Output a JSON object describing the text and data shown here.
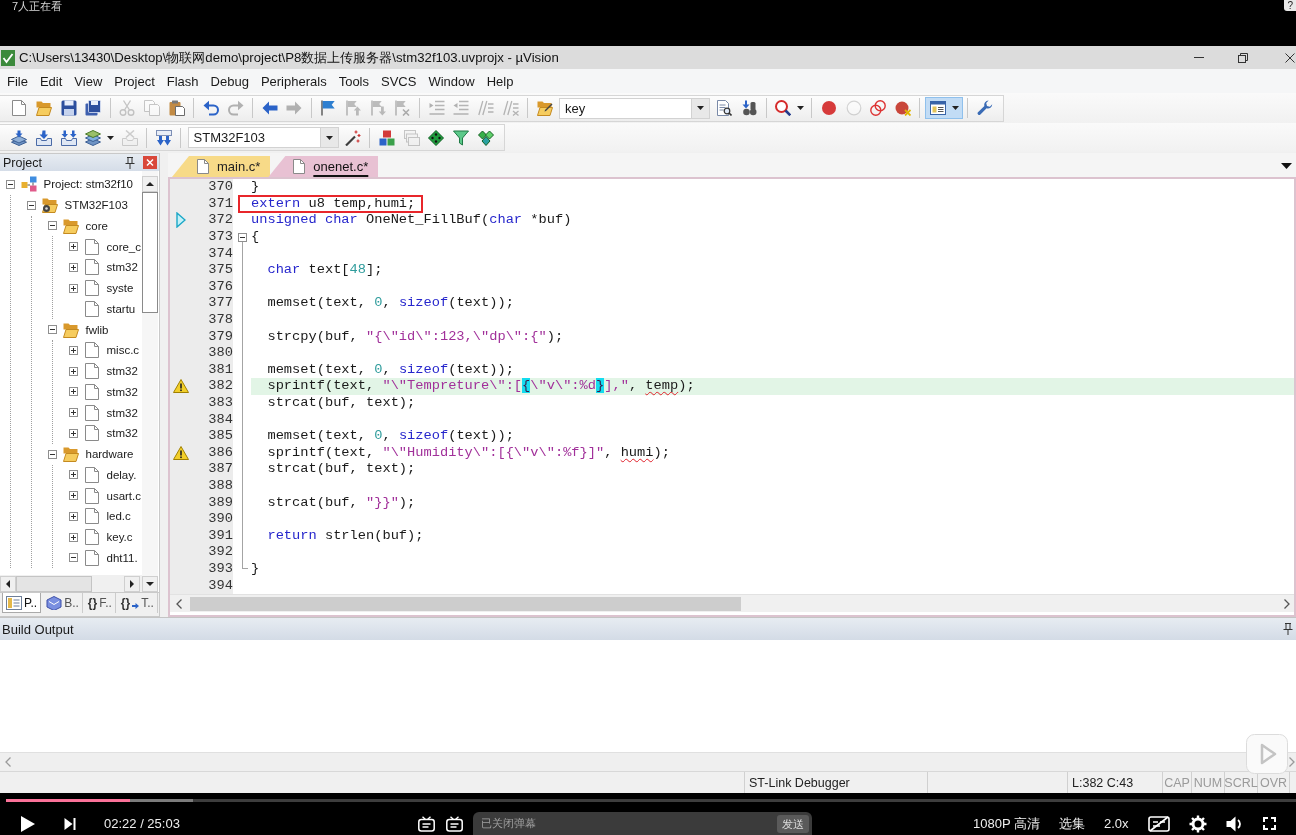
{
  "overlay": {
    "viewers": "7人正在看",
    "help": "?"
  },
  "window": {
    "title": "C:\\Users\\13430\\Desktop\\物联网demo\\project\\P8数据上传服务器\\stm32f103.uvprojx - µVision"
  },
  "menu": [
    "File",
    "Edit",
    "View",
    "Project",
    "Flash",
    "Debug",
    "Peripherals",
    "Tools",
    "SVCS",
    "Window",
    "Help"
  ],
  "toolbars": [
    [
      {
        "kind": "new",
        "disabled": false
      },
      {
        "kind": "open",
        "disabled": false
      },
      {
        "kind": "save",
        "disabled": false
      },
      {
        "kind": "save_all",
        "disabled": false
      },
      {
        "kind": "separator"
      },
      {
        "kind": "cut",
        "disabled": true
      },
      {
        "kind": "copy",
        "disabled": true
      },
      {
        "kind": "paste",
        "disabled": false
      },
      {
        "kind": "separator"
      },
      {
        "kind": "undo",
        "disabled": false
      },
      {
        "kind": "redo",
        "disabled": true
      },
      {
        "kind": "separator"
      },
      {
        "kind": "back",
        "disabled": false
      },
      {
        "kind": "forward",
        "disabled": true
      },
      {
        "kind": "separator"
      },
      {
        "kind": "bookmark",
        "disabled": false
      },
      {
        "kind": "bookmark_prev",
        "disabled": true
      },
      {
        "kind": "bookmark_next",
        "disabled": true
      },
      {
        "kind": "bookmark_clear",
        "disabled": true
      },
      {
        "kind": "separator"
      },
      {
        "kind": "indent",
        "disabled": true
      },
      {
        "kind": "unindent",
        "disabled": true
      },
      {
        "kind": "comment",
        "disabled": true
      },
      {
        "kind": "uncomment",
        "disabled": true
      },
      {
        "kind": "separator"
      },
      {
        "kind": "find_in_files",
        "disabled": false
      },
      {
        "kind": "combo",
        "value": "key"
      },
      {
        "kind": "find",
        "disabled": false
      },
      {
        "kind": "incremental_find",
        "disabled": false
      },
      {
        "kind": "separator"
      },
      {
        "kind": "debug",
        "disabled": false,
        "menu": true
      },
      {
        "kind": "separator"
      },
      {
        "kind": "breakpoint",
        "disabled": false
      },
      {
        "kind": "breakpoint_enable",
        "disabled": true
      },
      {
        "kind": "breakpoints_disable",
        "disabled": false
      },
      {
        "kind": "breakpoints_kill",
        "disabled": false
      },
      {
        "kind": "separator"
      },
      {
        "kind": "window",
        "disabled": false,
        "menu": true,
        "highlighted": true
      },
      {
        "kind": "separator"
      },
      {
        "kind": "configure",
        "disabled": false
      }
    ],
    [
      {
        "kind": "translate",
        "disabled": false
      },
      {
        "kind": "build",
        "disabled": false
      },
      {
        "kind": "rebuild",
        "disabled": false
      },
      {
        "kind": "batch_build",
        "disabled": false,
        "menu": true
      },
      {
        "kind": "stop_build",
        "disabled": true
      },
      {
        "kind": "separator"
      },
      {
        "kind": "download",
        "disabled": false
      },
      {
        "kind": "separator"
      },
      {
        "kind": "combo",
        "value": "STM32F103"
      },
      {
        "kind": "target_options",
        "disabled": false
      },
      {
        "kind": "separator"
      },
      {
        "kind": "components",
        "disabled": false
      },
      {
        "kind": "manage",
        "disabled": true
      },
      {
        "kind": "packs",
        "disabled": false
      },
      {
        "kind": "select_packs",
        "disabled": false
      },
      {
        "kind": "pack_installer",
        "disabled": false
      }
    ]
  ],
  "project_panel": {
    "title": "Project",
    "tree": [
      {
        "label": "Project: stm32f10",
        "kind": "project",
        "expanded": true,
        "children": [
          {
            "label": "STM32F103",
            "kind": "target",
            "expanded": true,
            "children": [
              {
                "label": "core",
                "kind": "group",
                "expanded": true,
                "children": [
                  {
                    "label": "core_c",
                    "kind": "file",
                    "expanded": false
                  },
                  {
                    "label": "stm32",
                    "kind": "file",
                    "expanded": false
                  },
                  {
                    "label": "syste",
                    "kind": "file",
                    "expanded": false
                  },
                  {
                    "label": "startu",
                    "kind": "file"
                  }
                ]
              },
              {
                "label": "fwlib",
                "kind": "group",
                "expanded": true,
                "children": [
                  {
                    "label": "misc.c",
                    "kind": "file",
                    "expanded": false
                  },
                  {
                    "label": "stm32",
                    "kind": "file",
                    "expanded": false
                  },
                  {
                    "label": "stm32",
                    "kind": "file",
                    "expanded": false
                  },
                  {
                    "label": "stm32",
                    "kind": "file",
                    "expanded": false
                  },
                  {
                    "label": "stm32",
                    "kind": "file",
                    "expanded": false
                  }
                ]
              },
              {
                "label": "hardware",
                "kind": "group",
                "expanded": true,
                "children": [
                  {
                    "label": "delay.",
                    "kind": "file",
                    "expanded": false
                  },
                  {
                    "label": "usart.c",
                    "kind": "file",
                    "expanded": false
                  },
                  {
                    "label": "led.c",
                    "kind": "file",
                    "expanded": false
                  },
                  {
                    "label": "key.c",
                    "kind": "file",
                    "expanded": false
                  },
                  {
                    "label": "dht11.",
                    "kind": "file",
                    "expanded": true
                  }
                ]
              }
            ]
          }
        ]
      }
    ],
    "tabs": [
      {
        "kind": "project",
        "label": "P..",
        "selected": true
      },
      {
        "kind": "books",
        "label": "B..",
        "selected": false
      },
      {
        "kind": "functions",
        "glyph": "{}",
        "label": "F..",
        "selected": false
      },
      {
        "kind": "templates",
        "glyph": "{}",
        "label": "T..",
        "selected": false
      }
    ]
  },
  "editor": {
    "tabs": [
      {
        "label": "main.c*",
        "color": "#f7da88",
        "selected": false
      },
      {
        "label": "onenet.c*",
        "color": "#e8c1d3",
        "selected": true
      }
    ],
    "lines": [
      {
        "number": "370",
        "current": false,
        "boxed": false,
        "tokens": [
          {
            "kind": "plain",
            "text": "}"
          }
        ]
      },
      {
        "number": "371",
        "current": false,
        "boxed": true,
        "tokens": [
          {
            "kind": "keyword",
            "text": "extern"
          },
          {
            "kind": "plain",
            "text": " u8 temp,humi;"
          }
        ]
      },
      {
        "number": "372",
        "current": false,
        "boxed": false,
        "marker": {
          "kind": "arrow"
        },
        "tokens": [
          {
            "kind": "keyword",
            "text": "unsigned"
          },
          {
            "kind": "keyword",
            "text": " char"
          },
          {
            "kind": "plain",
            "text": " OneNet_FillBuf("
          },
          {
            "kind": "keyword",
            "text": "char"
          },
          {
            "kind": "plain",
            "text": " *buf)"
          }
        ]
      },
      {
        "number": "373",
        "current": false,
        "boxed": false,
        "fold": {
          "kind": "start"
        },
        "tokens": [
          {
            "kind": "plain",
            "text": "{"
          }
        ]
      },
      {
        "number": "374",
        "current": false,
        "boxed": false,
        "fold": {
          "kind": "inside"
        }
      },
      {
        "number": "375",
        "current": false,
        "boxed": false,
        "fold": {
          "kind": "inside"
        },
        "tokens": [
          {
            "kind": "keyword",
            "text": "  char"
          },
          {
            "kind": "plain",
            "text": " text["
          },
          {
            "kind": "number",
            "text": "48"
          },
          {
            "kind": "plain",
            "text": "];"
          }
        ]
      },
      {
        "number": "376",
        "current": false,
        "boxed": false,
        "fold": {
          "kind": "inside"
        }
      },
      {
        "number": "377",
        "current": false,
        "boxed": false,
        "fold": {
          "kind": "inside"
        },
        "tokens": [
          {
            "kind": "plain",
            "text": "  memset(text, "
          },
          {
            "kind": "number",
            "text": "0"
          },
          {
            "kind": "plain",
            "text": ", "
          },
          {
            "kind": "keyword",
            "text": "sizeof"
          },
          {
            "kind": "plain",
            "text": "(text));"
          }
        ]
      },
      {
        "number": "378",
        "current": false,
        "boxed": false,
        "fold": {
          "kind": "inside"
        }
      },
      {
        "number": "379",
        "current": false,
        "boxed": false,
        "fold": {
          "kind": "inside"
        },
        "tokens": [
          {
            "kind": "plain",
            "text": "  strcpy(buf, "
          },
          {
            "kind": "string",
            "text": "\"{\\\"id\\\":123,\\\"dp\\\":{\""
          },
          {
            "kind": "plain",
            "text": ");"
          }
        ]
      },
      {
        "number": "380",
        "current": false,
        "boxed": false,
        "fold": {
          "kind": "inside"
        }
      },
      {
        "number": "381",
        "current": false,
        "boxed": false,
        "fold": {
          "kind": "inside"
        },
        "tokens": [
          {
            "kind": "plain",
            "text": "  memset(text, "
          },
          {
            "kind": "number",
            "text": "0"
          },
          {
            "kind": "plain",
            "text": ", "
          },
          {
            "kind": "keyword",
            "text": "sizeof"
          },
          {
            "kind": "plain",
            "text": "(text));"
          }
        ]
      },
      {
        "number": "382",
        "current": true,
        "boxed": false,
        "marker": {
          "kind": "warning"
        },
        "fold": {
          "kind": "inside"
        },
        "tokens": [
          {
            "kind": "plain",
            "text": "  sprintf(text, "
          },
          {
            "kind": "string",
            "text": "\"\\\"Tempreture\\\":["
          },
          {
            "kind": "match",
            "text": "{"
          },
          {
            "kind": "string",
            "text": "\\\"v\\\":%d"
          },
          {
            "kind": "match",
            "text": "}"
          },
          {
            "kind": "string",
            "text": "],\""
          },
          {
            "kind": "plain",
            "text": ", "
          },
          {
            "kind": "warn",
            "text": "temp"
          },
          {
            "kind": "plain",
            "text": ");"
          }
        ]
      },
      {
        "number": "383",
        "current": false,
        "boxed": false,
        "fold": {
          "kind": "inside"
        },
        "tokens": [
          {
            "kind": "plain",
            "text": "  strcat(buf, text);"
          }
        ]
      },
      {
        "number": "384",
        "current": false,
        "boxed": false,
        "fold": {
          "kind": "inside"
        }
      },
      {
        "number": "385",
        "current": false,
        "boxed": false,
        "fold": {
          "kind": "inside"
        },
        "tokens": [
          {
            "kind": "plain",
            "text": "  memset(text, "
          },
          {
            "kind": "number",
            "text": "0"
          },
          {
            "kind": "plain",
            "text": ", "
          },
          {
            "kind": "keyword",
            "text": "sizeof"
          },
          {
            "kind": "plain",
            "text": "(text));"
          }
        ]
      },
      {
        "number": "386",
        "current": false,
        "boxed": false,
        "marker": {
          "kind": "warning"
        },
        "fold": {
          "kind": "inside"
        },
        "tokens": [
          {
            "kind": "plain",
            "text": "  sprintf(text, "
          },
          {
            "kind": "string",
            "text": "\"\\\"Humidity\\\":[{\\\"v\\\":%f}]\""
          },
          {
            "kind": "plain",
            "text": ", "
          },
          {
            "kind": "warn",
            "text": "humi"
          },
          {
            "kind": "plain",
            "text": ");"
          }
        ]
      },
      {
        "number": "387",
        "current": false,
        "boxed": false,
        "fold": {
          "kind": "inside"
        },
        "tokens": [
          {
            "kind": "plain",
            "text": "  strcat(buf, text);"
          }
        ]
      },
      {
        "number": "388",
        "current": false,
        "boxed": false,
        "fold": {
          "kind": "inside"
        }
      },
      {
        "number": "389",
        "current": false,
        "boxed": false,
        "fold": {
          "kind": "inside"
        },
        "tokens": [
          {
            "kind": "plain",
            "text": "  strcat(buf, "
          },
          {
            "kind": "string",
            "text": "\"}}\""
          },
          {
            "kind": "plain",
            "text": ");"
          }
        ]
      },
      {
        "number": "390",
        "current": false,
        "boxed": false,
        "fold": {
          "kind": "inside"
        }
      },
      {
        "number": "391",
        "current": false,
        "boxed": false,
        "fold": {
          "kind": "inside"
        },
        "tokens": [
          {
            "kind": "keyword",
            "text": "  return"
          },
          {
            "kind": "plain",
            "text": " strlen(buf);"
          }
        ]
      },
      {
        "number": "392",
        "current": false,
        "boxed": false,
        "fold": {
          "kind": "inside"
        }
      },
      {
        "number": "393",
        "current": false,
        "boxed": false,
        "fold": {
          "kind": "end"
        },
        "tokens": [
          {
            "kind": "plain",
            "text": "}"
          }
        ]
      },
      {
        "number": "394",
        "current": false,
        "boxed": false
      }
    ]
  },
  "build_output": {
    "title": "Build Output"
  },
  "status_bar": {
    "debugger": "ST-Link Debugger",
    "position": "L:382 C:43",
    "indicators": [
      {
        "label": "CAP",
        "on": false
      },
      {
        "label": "NUM",
        "on": false
      },
      {
        "label": "SCRL",
        "on": false
      },
      {
        "label": "OVR",
        "on": false
      }
    ]
  },
  "player": {
    "progress": {
      "level": 0.096
    },
    "buffer": {
      "level": 0.145
    },
    "time": "02:22 / 25:03",
    "danmaku_input": {
      "placeholder": "已关闭弹幕"
    },
    "send_button": "发送",
    "quality": "1080P 高清",
    "episodes": "选集",
    "speed": "2.0x"
  }
}
